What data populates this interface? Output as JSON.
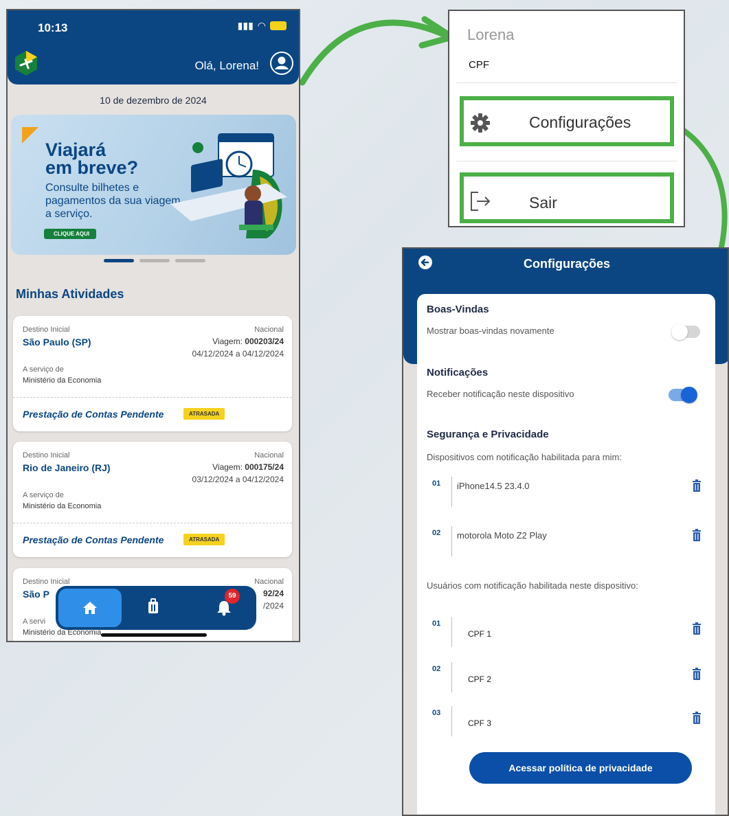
{
  "phone_home": {
    "status_time": "10:13",
    "greeting": "Olá, Lorena!",
    "date": "10 de dezembro de 2024",
    "banner": {
      "title_line1": "Viajará",
      "title_line2": "em breve?",
      "subtitle": "Consulte bilhetes e pagamentos da sua viagem a serviço.",
      "cta": "CLIQUE AQUI"
    },
    "section_title": "Minhas Atividades",
    "activities": [
      {
        "label_dest": "Destino Inicial",
        "city": "São Paulo (SP)",
        "scope": "Nacional",
        "trip_label": "Viagem:",
        "trip_no": "000203/24",
        "dates": "04/12/2024 a 04/12/2024",
        "service_label": "A serviço de",
        "org": "Ministério da Economia",
        "pending": "Prestação de Contas Pendente",
        "badge": "ATRASADA"
      },
      {
        "label_dest": "Destino Inicial",
        "city": "Rio de Janeiro (RJ)",
        "scope": "Nacional",
        "trip_label": "Viagem:",
        "trip_no": "000175/24",
        "dates": "03/12/2024 a 04/12/2024",
        "service_label": "A serviço de",
        "org": "Ministério da Economia",
        "pending": "Prestação de Contas Pendente",
        "badge": "ATRASADA"
      },
      {
        "label_dest": "Destino Inicial",
        "city": "São P",
        "scope": "Nacional",
        "trip_no": "92/24",
        "dates": "/2024",
        "service_label": "A servi",
        "org": "Ministério da Economia"
      }
    ],
    "nav": {
      "notifications_count": "59"
    }
  },
  "user_menu": {
    "name": "Lorena",
    "cpf_label": "CPF",
    "items": [
      {
        "label": "Configurações",
        "icon": "gear-icon"
      },
      {
        "label": "Sair",
        "icon": "logout-icon"
      }
    ]
  },
  "settings": {
    "title": "Configurações",
    "welcome": {
      "heading": "Boas-Vindas",
      "text": "Mostrar boas-vindas novamente",
      "enabled": false
    },
    "notifications": {
      "heading": "Notificações",
      "text": "Receber notificação neste dispositivo",
      "enabled": true
    },
    "security": {
      "heading": "Segurança e Privacidade",
      "devices_label": "Dispositivos com notificação habilitada para mim:",
      "devices": [
        {
          "num": "01",
          "name": "iPhone14.5 23.4.0"
        },
        {
          "num": "02",
          "name": "motorola Moto Z2 Play"
        }
      ],
      "users_label": "Usuários com notificação habilitada neste dispositivo:",
      "users": [
        {
          "num": "01",
          "name": "CPF 1"
        },
        {
          "num": "02",
          "name": "CPF 2"
        },
        {
          "num": "03",
          "name": "CPF 3"
        }
      ]
    },
    "privacy_button": "Acessar política de privacidade"
  },
  "colors": {
    "primary": "#0b4682",
    "highlight": "#4caf47",
    "badge": "#f4d21f",
    "notification": "#e0252b"
  }
}
